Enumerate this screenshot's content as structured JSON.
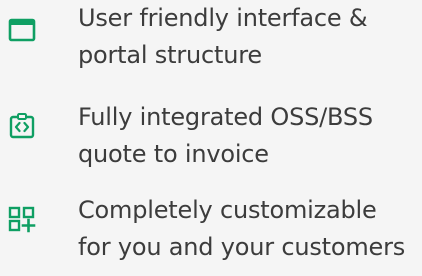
{
  "features": [
    {
      "icon": "window-icon",
      "line1": "User friendly interface &",
      "line2": "portal structure"
    },
    {
      "icon": "code-clipboard-icon",
      "line1": "Fully integrated OSS/BSS",
      "line2": "quote to invoice"
    },
    {
      "icon": "grid-add-icon",
      "line1": "Completely customizable",
      "line2": "for you and your customers"
    }
  ],
  "colors": {
    "icon_green": "#0f9f63",
    "text": "#3c3c3c",
    "background": "#f5f5f5"
  }
}
